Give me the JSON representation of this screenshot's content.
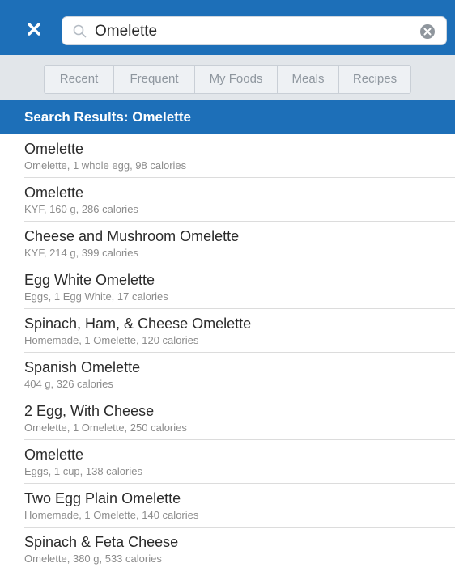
{
  "search": {
    "value": "Omelette",
    "placeholder": "Search"
  },
  "tabs": [
    "Recent",
    "Frequent",
    "My Foods",
    "Meals",
    "Recipes"
  ],
  "results_header": "Search Results: Omelette",
  "results": [
    {
      "name": "Omelette",
      "desc": "Omelette, 1 whole egg, 98 calories"
    },
    {
      "name": "Omelette",
      "desc": "KYF, 160 g, 286 calories"
    },
    {
      "name": "Cheese and Mushroom Omelette",
      "desc": "KYF, 214 g, 399 calories"
    },
    {
      "name": "Egg White Omelette",
      "desc": "Eggs, 1 Egg White, 17 calories"
    },
    {
      "name": "Spinach, Ham, & Cheese Omelette",
      "desc": "Homemade, 1 Omelette, 120 calories"
    },
    {
      "name": "Spanish Omelette",
      "desc": "404 g, 326 calories"
    },
    {
      "name": "2 Egg, With Cheese",
      "desc": "Omelette, 1 Omelette, 250 calories"
    },
    {
      "name": "Omelette",
      "desc": "Eggs, 1 cup, 138 calories"
    },
    {
      "name": "Two Egg Plain Omelette",
      "desc": "Homemade, 1 Omelette, 140 calories"
    },
    {
      "name": "Spinach & Feta Cheese",
      "desc": "Omelette, 380 g, 533 calories"
    }
  ],
  "icons": {
    "close": "close-icon",
    "search": "search-icon",
    "clear": "clear-icon"
  },
  "colors": {
    "brand_blue": "#1d6fb8",
    "tab_bar_bg": "#e2e6ea",
    "subtext": "#8c8c8c"
  }
}
